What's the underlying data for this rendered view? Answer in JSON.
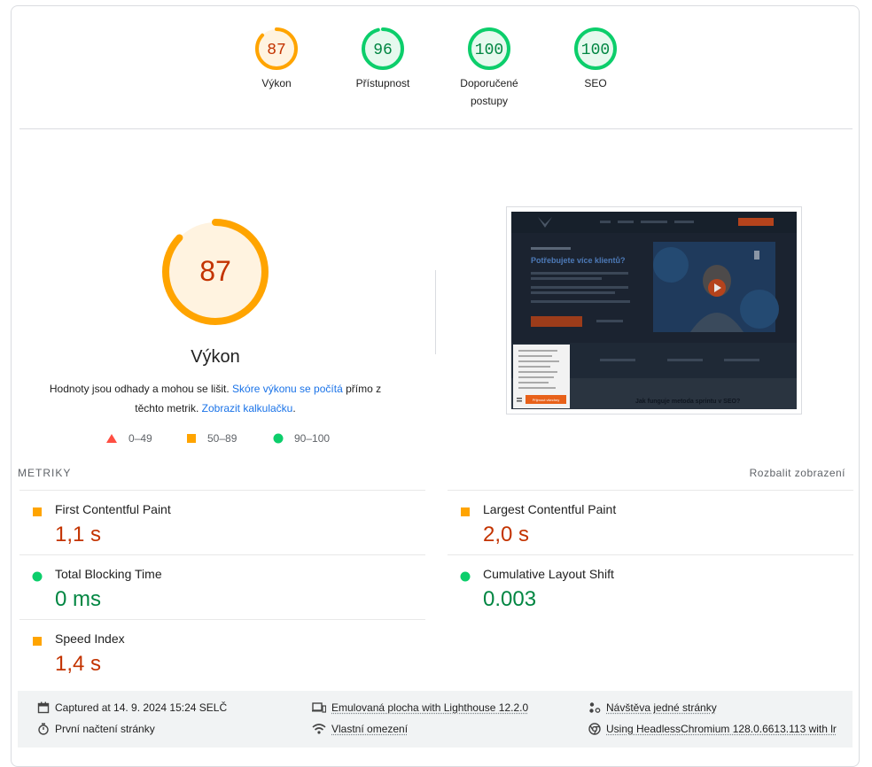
{
  "categories": [
    {
      "score": "87",
      "label": "Výkon",
      "value": 87,
      "color": "#ffa400",
      "fill": "#fff3e0",
      "text": "#c33300"
    },
    {
      "score": "96",
      "label": "Přístupnost",
      "value": 96,
      "color": "#0cce6b",
      "fill": "#e6f9ee",
      "text": "#018642"
    },
    {
      "score": "100",
      "label": "Doporučené postupy",
      "value": 100,
      "color": "#0cce6b",
      "fill": "#e6f9ee",
      "text": "#018642"
    },
    {
      "score": "100",
      "label": "SEO",
      "value": 100,
      "color": "#0cce6b",
      "fill": "#e6f9ee",
      "text": "#018642"
    }
  ],
  "performance": {
    "score": "87",
    "value": 87,
    "title": "Výkon",
    "desc_prefix": "Hodnoty jsou odhady a mohou se lišit. ",
    "desc_link1": "Skóre výkonu se počítá",
    "desc_mid": " přímo z těchto metrik. ",
    "desc_link2": "Zobrazit kalkulačku",
    "desc_suffix": "."
  },
  "legend": {
    "fail": "0–49",
    "average": "50–89",
    "pass": "90–100"
  },
  "metrics": {
    "header": "METRIKY",
    "expand": "Rozbalit zobrazení",
    "items": [
      {
        "name": "First Contentful Paint",
        "value": "1,1 s",
        "status": "average"
      },
      {
        "name": "Largest Contentful Paint",
        "value": "2,0 s",
        "status": "average"
      },
      {
        "name": "Total Blocking Time",
        "value": "0 ms",
        "status": "pass"
      },
      {
        "name": "Cumulative Layout Shift",
        "value": "0.003",
        "status": "pass"
      },
      {
        "name": "Speed Index",
        "value": "1,4 s",
        "status": "average"
      }
    ]
  },
  "screenshot": {
    "headline": "Potřebujete více klientů?",
    "bottom_text": "Jak funguje metoda sprintu v SEO?",
    "cookie_button": "Přijmout všechny"
  },
  "footer": {
    "captured": "Captured at 14. 9. 2024 15:24 SELČ",
    "first_load": "První načtení stránky",
    "emulated": "Emulovaná plocha with Lighthouse 12.2.0",
    "throttling": "Vlastní omezení",
    "single_visit": "Návštěva jedné stránky",
    "browser": "Using HeadlessChromium 128.0.6613.113 with lr"
  },
  "colors": {
    "average": "#ffa400",
    "pass": "#0cce6b",
    "fail": "#ff4e42",
    "link": "#1a73e8"
  }
}
